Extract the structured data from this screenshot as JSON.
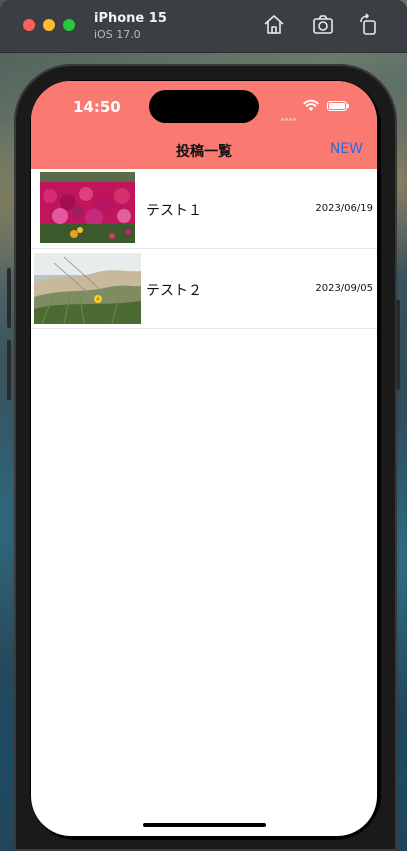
{
  "simulator": {
    "device_name": "iPhone 15",
    "os_version": "iOS 17.0",
    "toolbar_icons": [
      "home-icon",
      "screenshot-icon",
      "rotate-icon"
    ]
  },
  "status_bar": {
    "time": "14:50"
  },
  "nav": {
    "title": "投稿一覧",
    "new_label": "NEW"
  },
  "posts": [
    {
      "title": "テスト１",
      "date": "2023/06/19",
      "image": "pink-flowers-photo"
    },
    {
      "title": "テスト２",
      "date": "2023/09/05",
      "image": "dune-grass-photo"
    }
  ],
  "colors": {
    "nav_background": "#fa7a72",
    "new_link": "#2f6bd8"
  }
}
